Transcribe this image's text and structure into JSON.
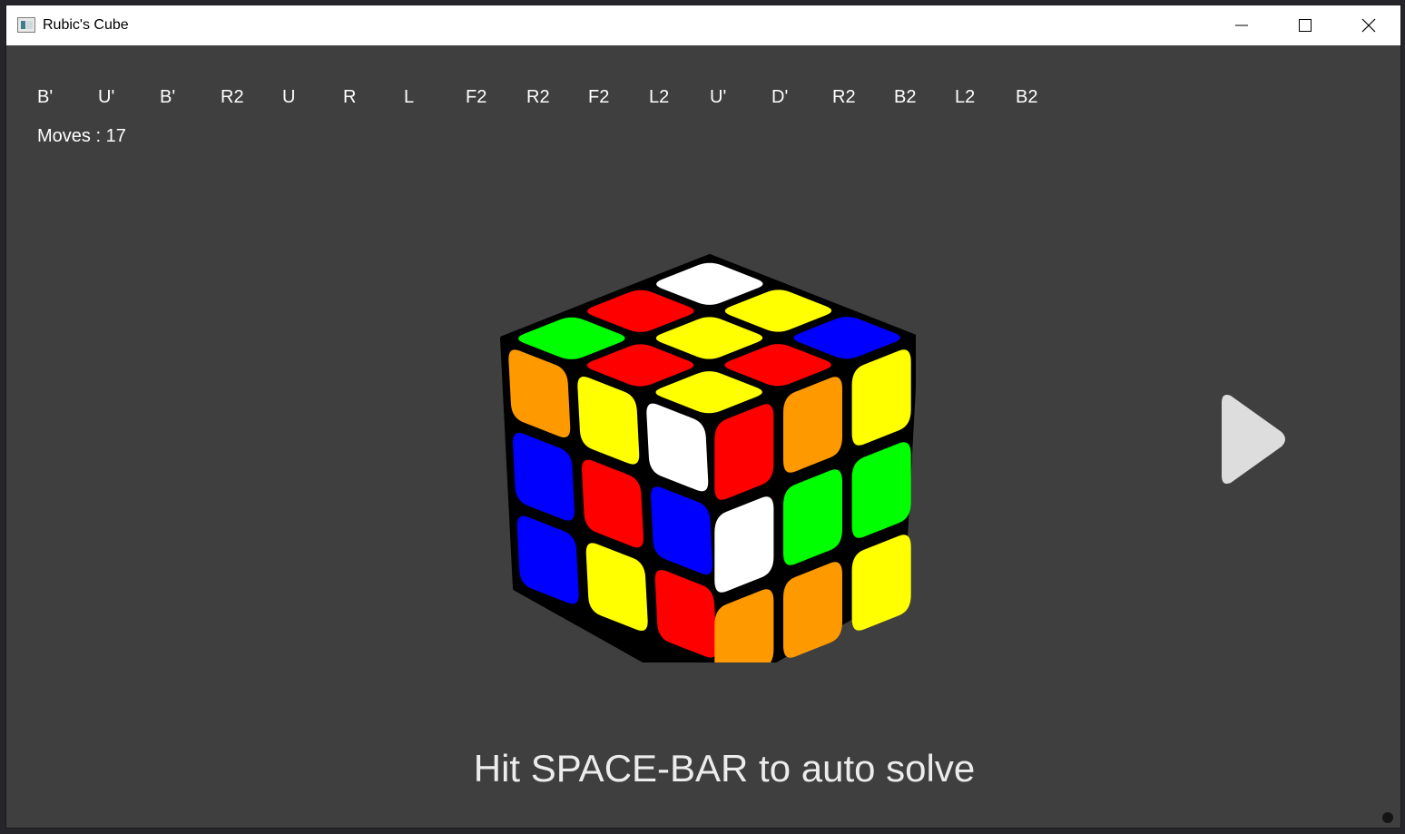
{
  "window": {
    "title": "Rubic's Cube"
  },
  "scramble": {
    "moves": [
      "B'",
      "U'",
      "B'",
      "R2",
      "U",
      "R",
      "L",
      "F2",
      "R2",
      "F2",
      "L2",
      "U'",
      "D'",
      "R2",
      "B2",
      "L2",
      "B2"
    ],
    "moves_label": "Moves : 17"
  },
  "hint": "Hit SPACE-BAR to auto solve",
  "icons": {
    "app": "app-icon",
    "minimize": "minimize-icon",
    "maximize": "maximize-icon",
    "close": "close-icon",
    "next": "play-arrow-icon"
  },
  "colors": {
    "background": "#3f3f3f",
    "red": "#ff0000",
    "green": "#00ff00",
    "blue": "#0000ff",
    "yellow": "#ffff00",
    "orange": "#ff9900",
    "white": "#ffffff"
  },
  "cube": {
    "up": [
      "white",
      "yellow",
      "blue",
      "red",
      "yellow",
      "red",
      "green",
      "red",
      "yellow"
    ],
    "left": [
      "orange",
      "blue",
      "blue",
      "yellow",
      "red",
      "yellow",
      "white",
      "blue",
      "red"
    ],
    "right": [
      "red",
      "white",
      "orange",
      "orange",
      "green",
      "orange",
      "yellow",
      "green",
      "yellow"
    ]
  }
}
